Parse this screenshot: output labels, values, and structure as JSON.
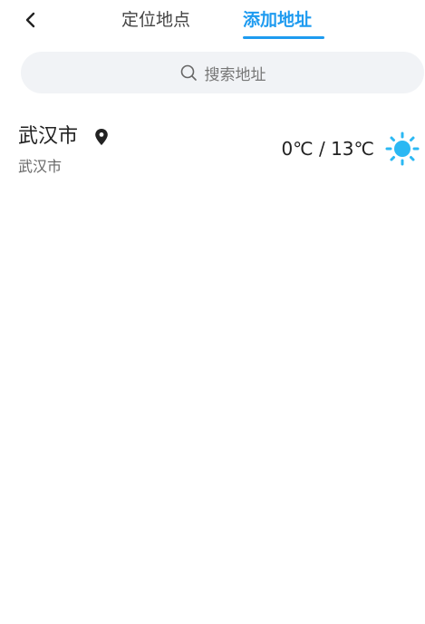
{
  "header": {
    "back_icon": "chevron-left-icon",
    "tabs": [
      {
        "label": "定位地点",
        "active": false
      },
      {
        "label": "添加地址",
        "active": true
      }
    ],
    "accent_color": "#1e9bf0"
  },
  "search": {
    "icon": "search-icon",
    "placeholder": "搜索地址"
  },
  "locations": [
    {
      "name": "武汉市",
      "subtitle": "武汉市",
      "is_current": true,
      "temperature": "0℃ / 13℃",
      "weather_icon": "sun-icon",
      "weather_color": "#2bb8f3"
    }
  ]
}
